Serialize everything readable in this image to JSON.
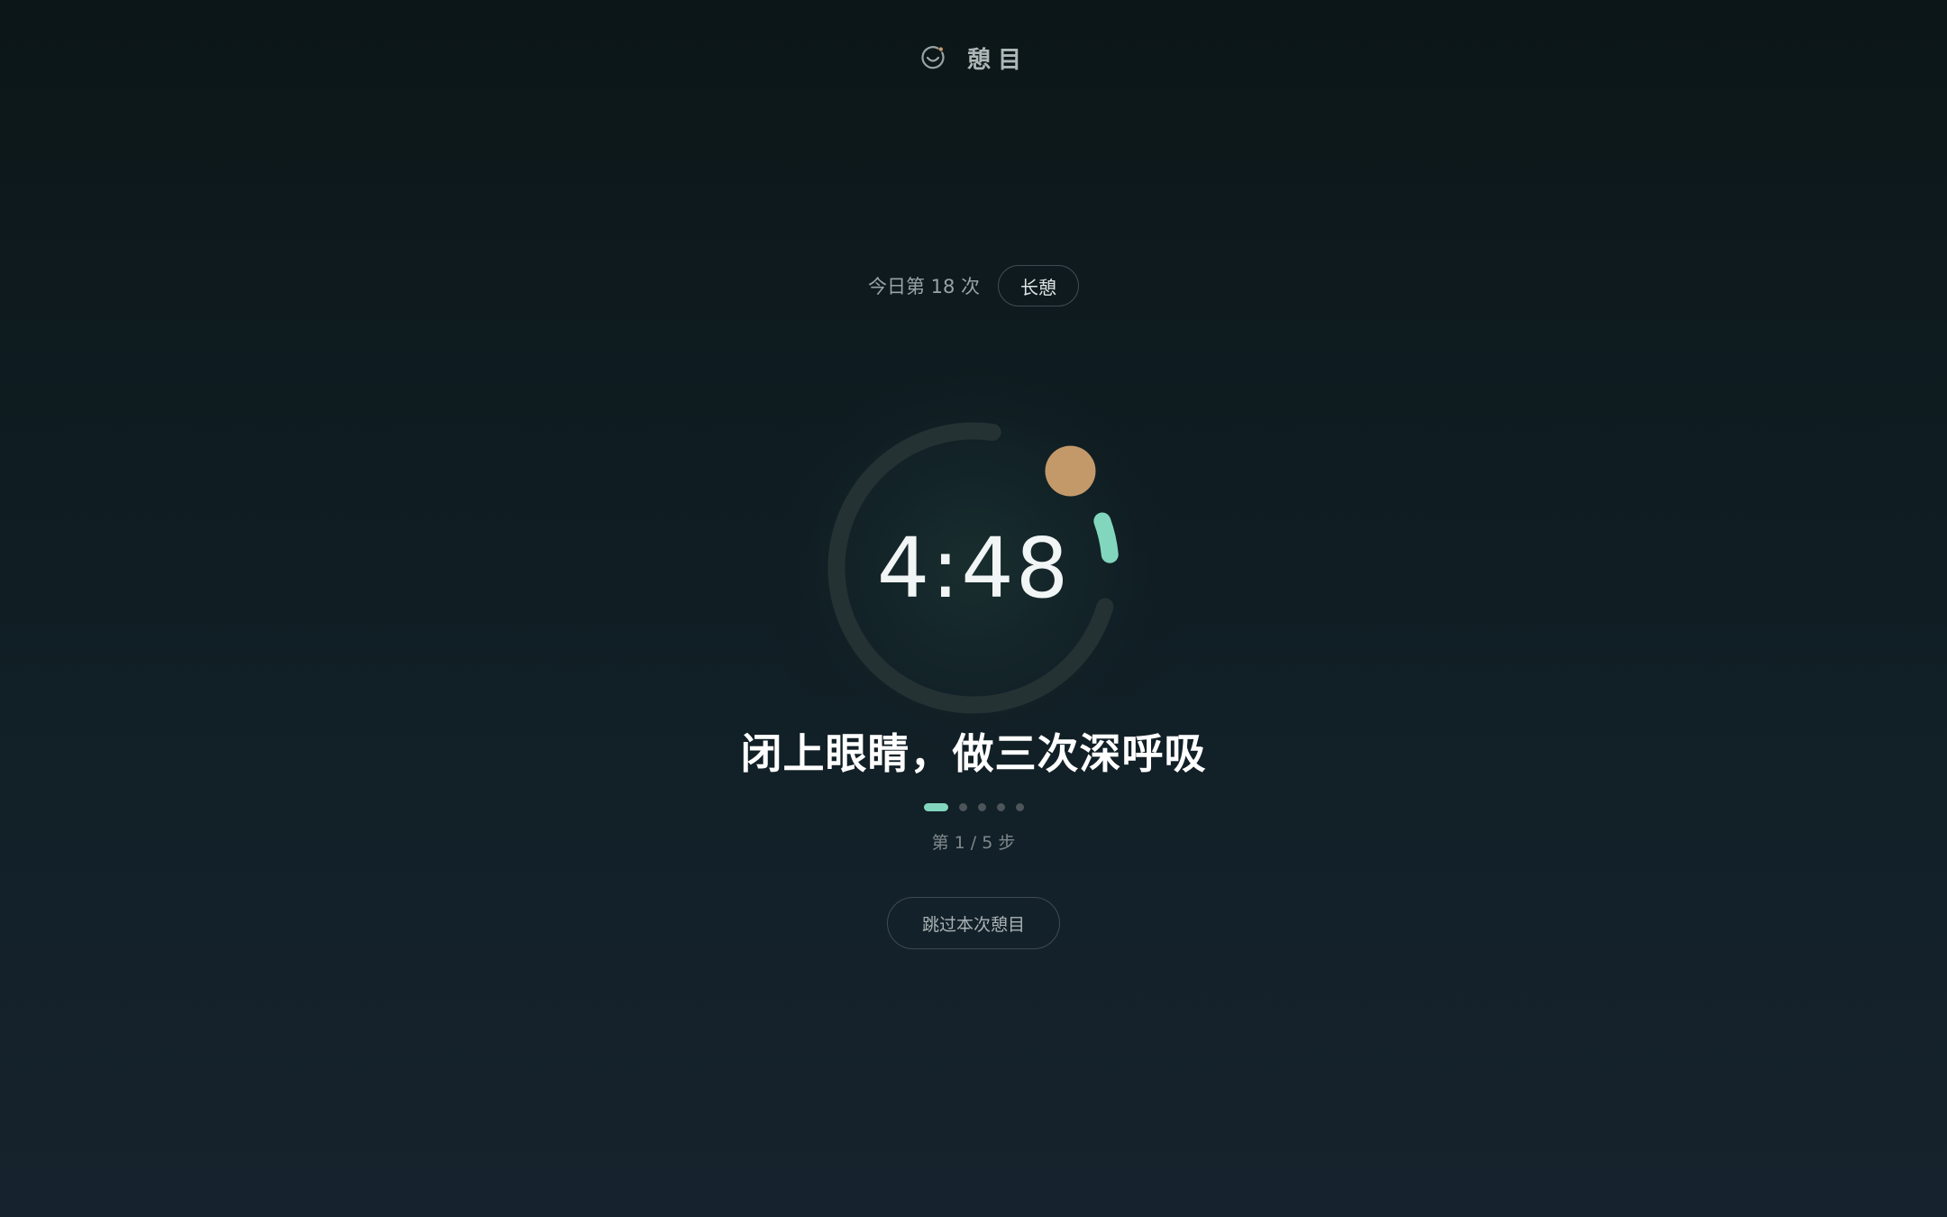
{
  "header": {
    "app_title": "憩目",
    "logo_icon": "smile-eye-icon"
  },
  "session": {
    "count_text": "今日第 18 次",
    "badge_label": "长憩"
  },
  "timer": {
    "display": "4:48",
    "elapsed_fraction": 0.04,
    "track_color": "#253234",
    "progress_color": "#82d6bd",
    "knob_color": "#c4996a"
  },
  "guide": {
    "instruction": "闭上眼睛，做三次深呼吸",
    "current_step": 1,
    "total_steps": 5,
    "step_label": "第 1 / 5 步"
  },
  "actions": {
    "skip_label": "跳过本次憩目"
  },
  "colors": {
    "accent": "#82d6bd",
    "sun": "#c4996a",
    "background_top": "#0c1618",
    "background_bottom": "#16222d"
  }
}
